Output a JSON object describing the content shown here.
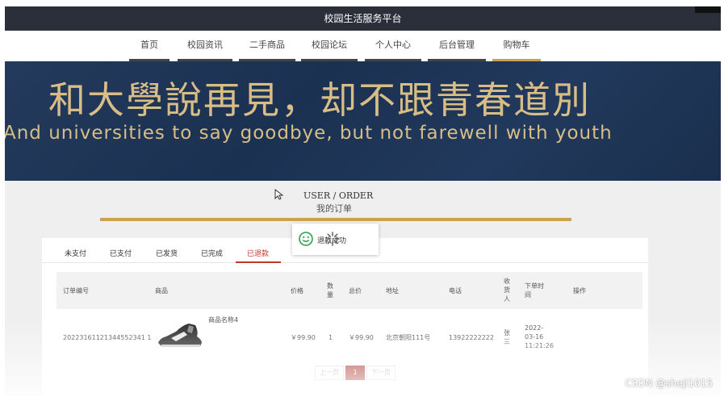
{
  "header": {
    "title": "校园生活服务平台"
  },
  "nav": {
    "items": [
      {
        "label": "首页"
      },
      {
        "label": "校园资讯"
      },
      {
        "label": "二手商品"
      },
      {
        "label": "校园论坛"
      },
      {
        "label": "个人中心"
      },
      {
        "label": "后台管理"
      },
      {
        "label": "购物车"
      }
    ],
    "active": "购物车"
  },
  "banner": {
    "cn": "和大學說再見，却不跟青春道別",
    "en": "And universities to say goodbye, but not farewell with youth"
  },
  "section": {
    "title_en": "USER / ORDER",
    "title_cn": "我的订单"
  },
  "toast": {
    "message": "退款成功"
  },
  "tabs": [
    {
      "label": "未支付"
    },
    {
      "label": "已支付"
    },
    {
      "label": "已发货"
    },
    {
      "label": "已完成"
    },
    {
      "label": "已退款"
    }
  ],
  "active_tab": "已退款",
  "table": {
    "headers": {
      "order_no": "订单编号",
      "product": "商品",
      "price": "价格",
      "qty": [
        "数",
        "量"
      ],
      "total": "总价",
      "address": "地址",
      "phone": "电话",
      "receiver": [
        "收",
        "货",
        "人"
      ],
      "time": [
        "下单时",
        "间"
      ],
      "action": "操作"
    },
    "rows": [
      {
        "order_no": "20223161121344552341 1",
        "product_name": "商品名称4",
        "price": "￥99.90",
        "qty": "1",
        "total": "￥99.90",
        "address": "北京朝阳111号",
        "phone": "13922222222",
        "receiver": [
          "张",
          "三"
        ],
        "time": [
          "2022-",
          "03-16",
          "11:21:26"
        ]
      }
    ]
  },
  "pager": {
    "prev": "上一页",
    "current": "1",
    "next": "下一页"
  },
  "watermark": "CSDN @sheji1015"
}
